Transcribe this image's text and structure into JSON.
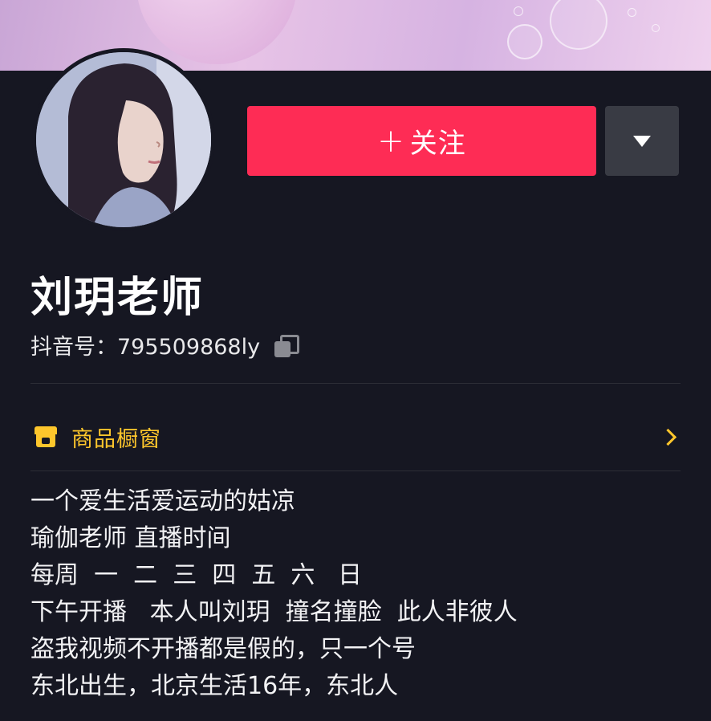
{
  "profile": {
    "name": "刘玥老师",
    "douyin_id": "抖音号：795509868ly",
    "follow_label": "关注",
    "follow_plus": "+"
  },
  "shop": {
    "label": "商品橱窗"
  },
  "bio": {
    "lines": [
      "一个爱生活爱运动的姑凉",
      "瑜伽老师 直播时间",
      "每周  一  二  三  四  五  六   日",
      "下午开播   本人叫刘玥  撞名撞脸  此人非彼人",
      "盗我视频不开播都是假的，只一个号",
      "东北出生，北京生活16年，东北人"
    ]
  },
  "colors": {
    "background": "#161722",
    "follow": "#fe2c55",
    "accent_yellow": "#fdc62c",
    "secondary_button": "#393b44"
  },
  "icons": {
    "follow_plus": "plus-icon",
    "more": "dropdown-triangle-icon",
    "copy": "copy-icon",
    "shop": "shop-icon",
    "chevron": "chevron-right-icon"
  }
}
